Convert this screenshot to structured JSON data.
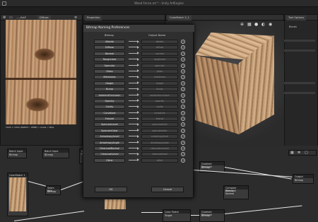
{
  "window": {
    "title": "Wood Fence.art * - Unity ArtEngine"
  },
  "panels": {
    "properties_tab": "Properties",
    "view2d": {
      "tab": "Diffuse",
      "path": "...../ArtE",
      "caption": "1024 × 1024 (RGB32 • 28KB) • Linear • Mips"
    },
    "view3d_tab": "ColorMatch 2_1",
    "tool_options": {
      "tab": "Tool Options",
      "brush_label": "Brush"
    }
  },
  "dialog": {
    "title": "Bitmap Naming Preferences",
    "col_bitmap": "Bitmap",
    "col_output": "Output Name",
    "rows": [
      {
        "bitmap": "Albedo",
        "output": "albedo"
      },
      {
        "bitmap": "Diffuse",
        "output": "diffuse"
      },
      {
        "bitmap": "Normal",
        "output": "normal"
      },
      {
        "bitmap": "Roughness",
        "output": "roughness"
      },
      {
        "bitmap": "Specular",
        "output": "specular"
      },
      {
        "bitmap": "Gloss",
        "output": "gloss"
      },
      {
        "bitmap": "Metalness",
        "output": "metalness"
      },
      {
        "bitmap": "Height",
        "output": "height"
      },
      {
        "bitmap": "Bump",
        "output": "bump"
      },
      {
        "bitmap": "AmbientOcclusion",
        "output": "ambientocclusion"
      },
      {
        "bitmap": "Opacity",
        "output": "opacity"
      },
      {
        "bitmap": "Cavity",
        "output": "cavity"
      },
      {
        "bitmap": "Curvature",
        "output": "curvature"
      },
      {
        "bitmap": "Fresnel",
        "output": "fresnel"
      },
      {
        "bitmap": "SpecularLevel",
        "output": "specularlevel"
      },
      {
        "bitmap": "SpecularColor",
        "output": "specularcolor"
      },
      {
        "bitmap": "AnisotropyLevel",
        "output": "anisotropylevel"
      },
      {
        "bitmap": "AnisotropyAngle",
        "output": "anisotropyangle"
      },
      {
        "bitmap": "ClearcoatNormal",
        "output": "clearcoatnormal"
      },
      {
        "bitmap": "ClearcoatLevel",
        "output": "clearcoatlevel"
      },
      {
        "bitmap": "Other",
        "output": "other"
      }
    ],
    "reset_glyph": "↺",
    "ok_label": "OK",
    "cancel_label": "Cancel"
  },
  "graph": {
    "nodes": {
      "batch_input_1": "Batch Input",
      "batch_input_2": "Batch Input",
      "color_match_1": "ColorMatch 1",
      "seam_painter": "Seam Pain",
      "gradient_removal_1": "Gradient Removal",
      "gradient_removal_2": "Gradient Removal",
      "color_match_2": "Color Match",
      "output": "Output",
      "compare": "Compare Removal"
    },
    "port_bitmap": "Bitmap",
    "port_albedo": "Albedo",
    "port_normal": "Normal",
    "port_target": "Target"
  }
}
